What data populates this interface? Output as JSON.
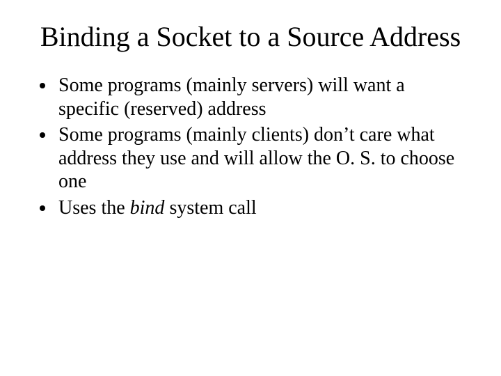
{
  "title": "Binding a Socket to a Source Address",
  "bullets": [
    {
      "text": "Some programs (mainly servers) will want a specific (reserved) address"
    },
    {
      "text": "Some programs (mainly clients) don’t care what address they use and will allow the O. S. to choose one"
    },
    {
      "prefix": "Uses the ",
      "italic": "bind",
      "suffix": " system call"
    }
  ]
}
